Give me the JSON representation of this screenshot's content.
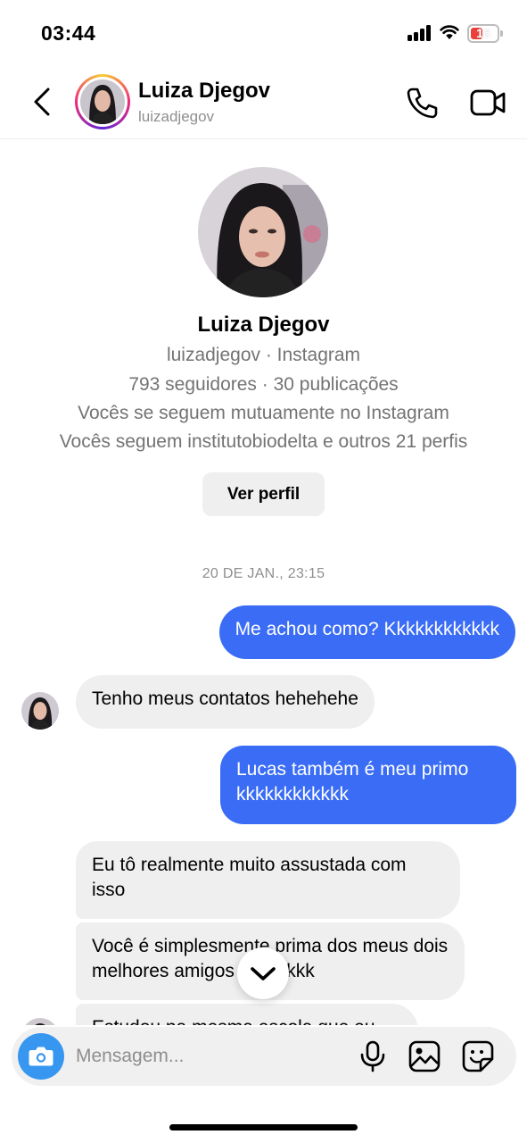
{
  "status_bar": {
    "time": "03:44",
    "battery_level": "16",
    "signal_bars": 4
  },
  "header": {
    "name": "Luiza Djegov",
    "username": "luizadjegov",
    "icons": [
      "back-chevron-icon",
      "phone-icon",
      "video-camera-icon"
    ]
  },
  "profile": {
    "name": "Luiza Djegov",
    "subtitle": "luizadjegov · Instagram",
    "stats": "793 seguidores · 30 publicações",
    "mutual": "Vocês se seguem mutuamente no Instagram",
    "follows": "Vocês seguem institutobiodelta e outros 21 perfis",
    "view_profile_label": "Ver perfil"
  },
  "thread": {
    "date_separator": "20 DE JAN., 23:15",
    "messages": [
      {
        "direction": "out",
        "text": "Me achou como? Kkkkkkkkkkkk"
      },
      {
        "direction": "in",
        "text": "Tenho meus contatos hehehehe"
      },
      {
        "direction": "out",
        "text": "Lucas também é meu primo kkkkkkkkkkkk"
      },
      {
        "direction": "in",
        "text": "Eu tô realmente muito assustada com isso"
      },
      {
        "direction": "in",
        "text": "Você é simplesmente prima dos meus dois melhores amigos kkkkkkkk"
      },
      {
        "direction": "in",
        "text": "Estudou na mesma escola que eu"
      }
    ]
  },
  "composer": {
    "placeholder": "Mensagem...",
    "icons": [
      "camera-icon",
      "microphone-icon",
      "gallery-icon",
      "sticker-icon"
    ]
  },
  "colors": {
    "outgoing_bubble": "#3a6cf5",
    "incoming_bubble": "#efefef",
    "camera_button": "#3797f0",
    "battery_low": "#e9413a"
  }
}
